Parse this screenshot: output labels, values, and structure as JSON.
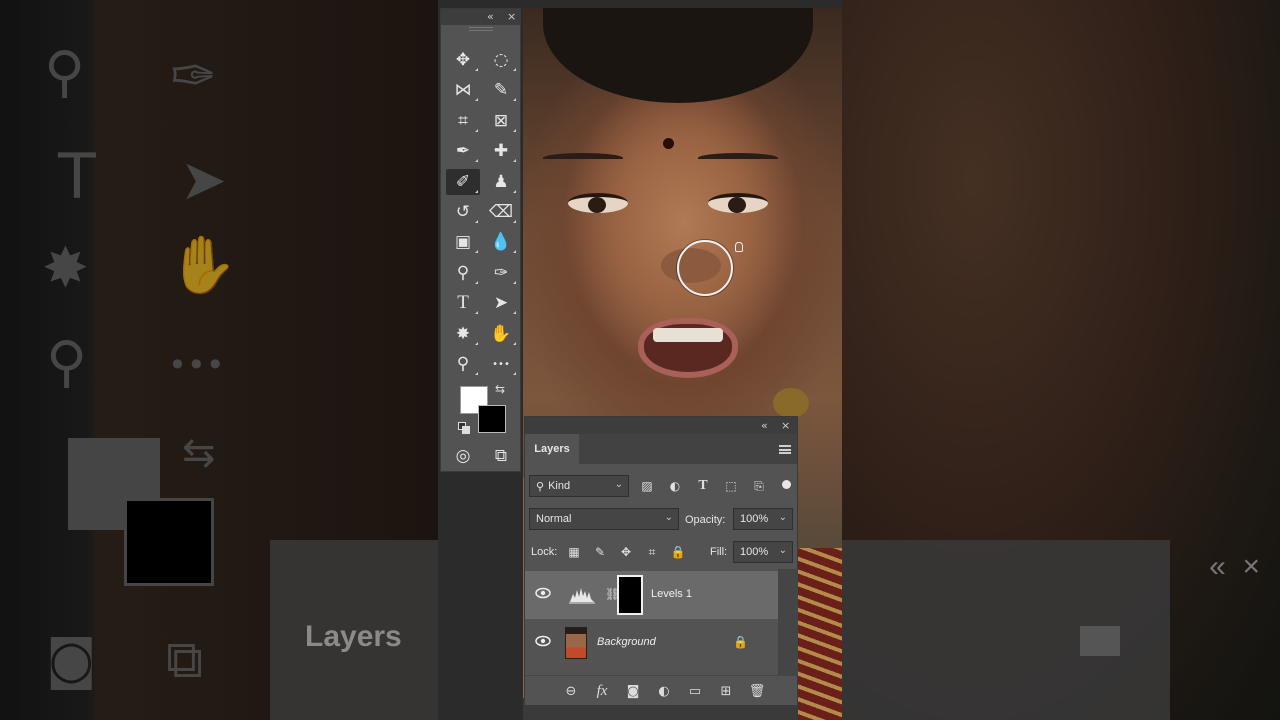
{
  "toolbar": {
    "collapse_glyph": "«",
    "close_glyph": "×",
    "tools": [
      {
        "name": "move-tool",
        "icon": "move-icon",
        "glyph": "✥"
      },
      {
        "name": "marquee-tool",
        "icon": "elliptical-marquee-icon",
        "glyph": "◌"
      },
      {
        "name": "lasso-tool",
        "icon": "polygonal-lasso-icon",
        "glyph": "⋈"
      },
      {
        "name": "quick-select-tool",
        "icon": "quick-select-icon",
        "glyph": "✎"
      },
      {
        "name": "crop-tool",
        "icon": "crop-icon",
        "glyph": "⌗"
      },
      {
        "name": "frame-tool",
        "icon": "frame-icon",
        "glyph": "⊠"
      },
      {
        "name": "eyedropper-tool",
        "icon": "eyedropper-icon",
        "glyph": "✒"
      },
      {
        "name": "healing-brush-tool",
        "icon": "bandage-icon",
        "glyph": "✚"
      },
      {
        "name": "brush-tool",
        "icon": "brush-icon",
        "glyph": "✐"
      },
      {
        "name": "clone-stamp-tool",
        "icon": "stamp-icon",
        "glyph": "♟"
      },
      {
        "name": "history-brush-tool",
        "icon": "history-brush-icon",
        "glyph": "↺"
      },
      {
        "name": "eraser-tool",
        "icon": "eraser-icon",
        "glyph": "⌫"
      },
      {
        "name": "gradient-tool",
        "icon": "gradient-icon",
        "glyph": "▣"
      },
      {
        "name": "blur-tool",
        "icon": "drop-icon",
        "glyph": "💧"
      },
      {
        "name": "dodge-tool",
        "icon": "dodge-icon",
        "glyph": "⚲"
      },
      {
        "name": "pen-tool",
        "icon": "pen-icon",
        "glyph": "✑"
      },
      {
        "name": "type-tool",
        "icon": "type-icon",
        "glyph": "T"
      },
      {
        "name": "path-select-tool",
        "icon": "arrow-icon",
        "glyph": "➤"
      },
      {
        "name": "shape-tool",
        "icon": "custom-shape-icon",
        "glyph": "✸"
      },
      {
        "name": "hand-tool",
        "icon": "hand-icon",
        "glyph": "✋"
      },
      {
        "name": "zoom-tool",
        "icon": "zoom-icon",
        "glyph": "⚲"
      },
      {
        "name": "more-tools",
        "icon": "more-icon",
        "glyph": "•••"
      }
    ],
    "swap_glyph": "⇆",
    "quick_mask_glyph": "◎",
    "screen_mode_glyph": "⧉",
    "foreground_color": "#ffffff",
    "background_color": "#000000"
  },
  "layers_panel": {
    "collapse_glyph": "«",
    "close_glyph": "×",
    "tab_label": "Layers",
    "filter": {
      "search_glyph": "⚲",
      "value": "Kind"
    },
    "filter_icons": [
      {
        "name": "filter-pixel-icon",
        "glyph": "▨"
      },
      {
        "name": "filter-adjustment-icon",
        "glyph": "◐"
      },
      {
        "name": "filter-type-icon",
        "glyph": "T"
      },
      {
        "name": "filter-shape-icon",
        "glyph": "⬚"
      },
      {
        "name": "filter-smart-object-icon",
        "glyph": "⎘"
      }
    ],
    "blend_mode": "Normal",
    "opacity_label": "Opacity:",
    "opacity_value": "100%",
    "lock_label": "Lock:",
    "lock_icons": [
      {
        "name": "lock-transparent-icon",
        "glyph": "▦"
      },
      {
        "name": "lock-pixels-icon",
        "glyph": "✎"
      },
      {
        "name": "lock-position-icon",
        "glyph": "✥"
      },
      {
        "name": "lock-artboard-icon",
        "glyph": "⌗"
      },
      {
        "name": "lock-all-icon",
        "glyph": "🔒"
      }
    ],
    "fill_label": "Fill:",
    "fill_value": "100%",
    "layers": [
      {
        "name": "Levels 1",
        "selected": true,
        "visible": true,
        "chain_glyph": "⛓"
      },
      {
        "name": "Background",
        "selected": false,
        "visible": true,
        "lock_glyph": "🔒"
      }
    ],
    "footer": [
      {
        "name": "link-layers-icon",
        "glyph": "⊖"
      },
      {
        "name": "fx-icon",
        "glyph": "fx"
      },
      {
        "name": "add-mask-icon",
        "glyph": "◙"
      },
      {
        "name": "new-adjustment-icon",
        "glyph": "◐"
      },
      {
        "name": "new-group-icon",
        "glyph": "▭"
      },
      {
        "name": "new-layer-icon",
        "glyph": "⊞"
      },
      {
        "name": "delete-layer-icon",
        "glyph": "🗑"
      }
    ]
  },
  "background_zoom": {
    "layers_label": "Layers",
    "collapse_glyph": "«",
    "close_glyph": "×",
    "type_glyph": "T",
    "arrow_glyph": "➤",
    "hand_glyph": "✋",
    "dots_glyph": "•••",
    "swap_glyph": "⇆"
  }
}
